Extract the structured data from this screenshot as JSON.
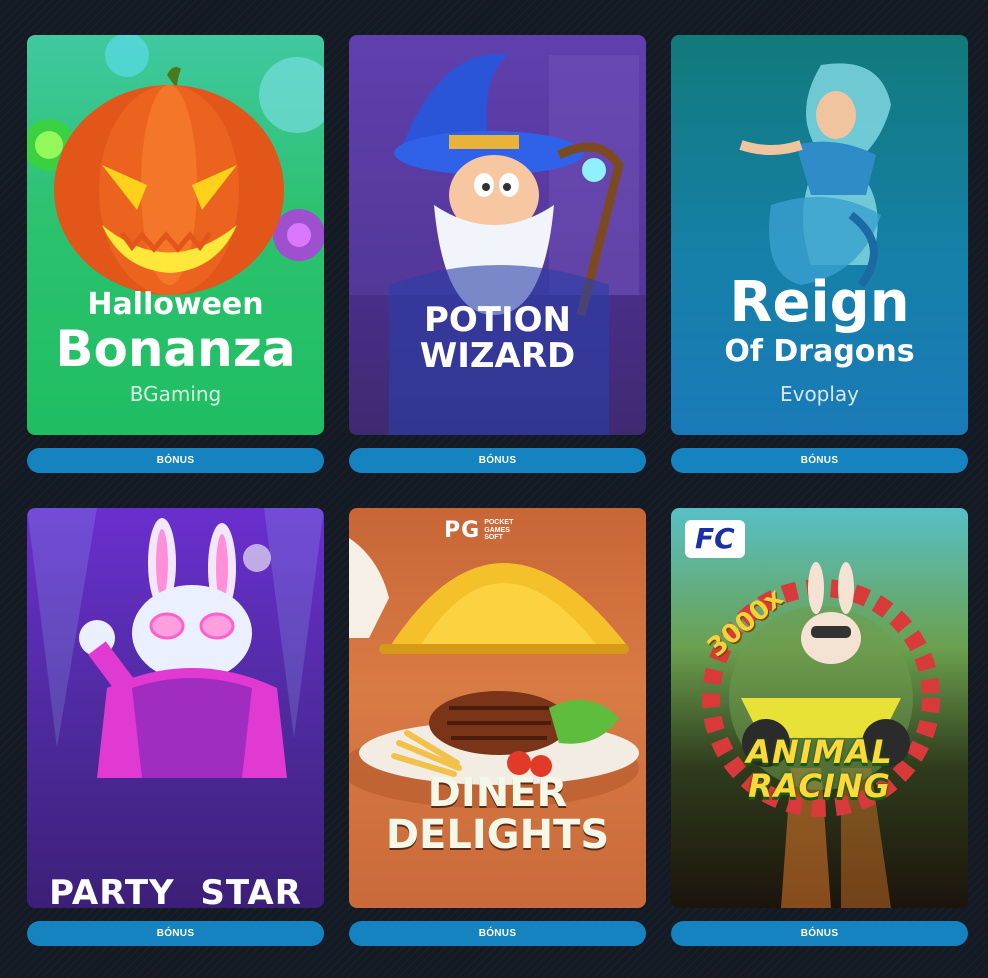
{
  "games": [
    {
      "key": "halloween",
      "title_top": "Halloween",
      "title_bottom": "Bonanza",
      "provider": "BGaming",
      "button": "BÓNUS"
    },
    {
      "key": "potion",
      "title_top": "POTION",
      "title_bottom": "WIZARD",
      "provider": "",
      "button": "BÓNUS"
    },
    {
      "key": "reign",
      "title_top": "Reign",
      "title_bottom": "Of Dragons",
      "provider": "Evoplay",
      "button": "BÓNUS"
    },
    {
      "key": "party",
      "title_top": "PARTY  STAR",
      "title_bottom": "",
      "provider": "",
      "button": "BÓNUS"
    },
    {
      "key": "diner",
      "title_top": "DINER",
      "title_bottom": "DELIGHTS",
      "provider": "",
      "button": "BÓNUS",
      "badge": "PG",
      "badge_sub": "POCKET GAMES SOFT"
    },
    {
      "key": "animal",
      "title_top": "ANIMAL",
      "title_bottom": "RACING",
      "provider": "",
      "button": "BÓNUS",
      "badge": "FC",
      "multiplier": "3000x"
    }
  ],
  "colors": {
    "background": "#141a24",
    "button": "#1483bf",
    "button_text": "#ffffff"
  }
}
